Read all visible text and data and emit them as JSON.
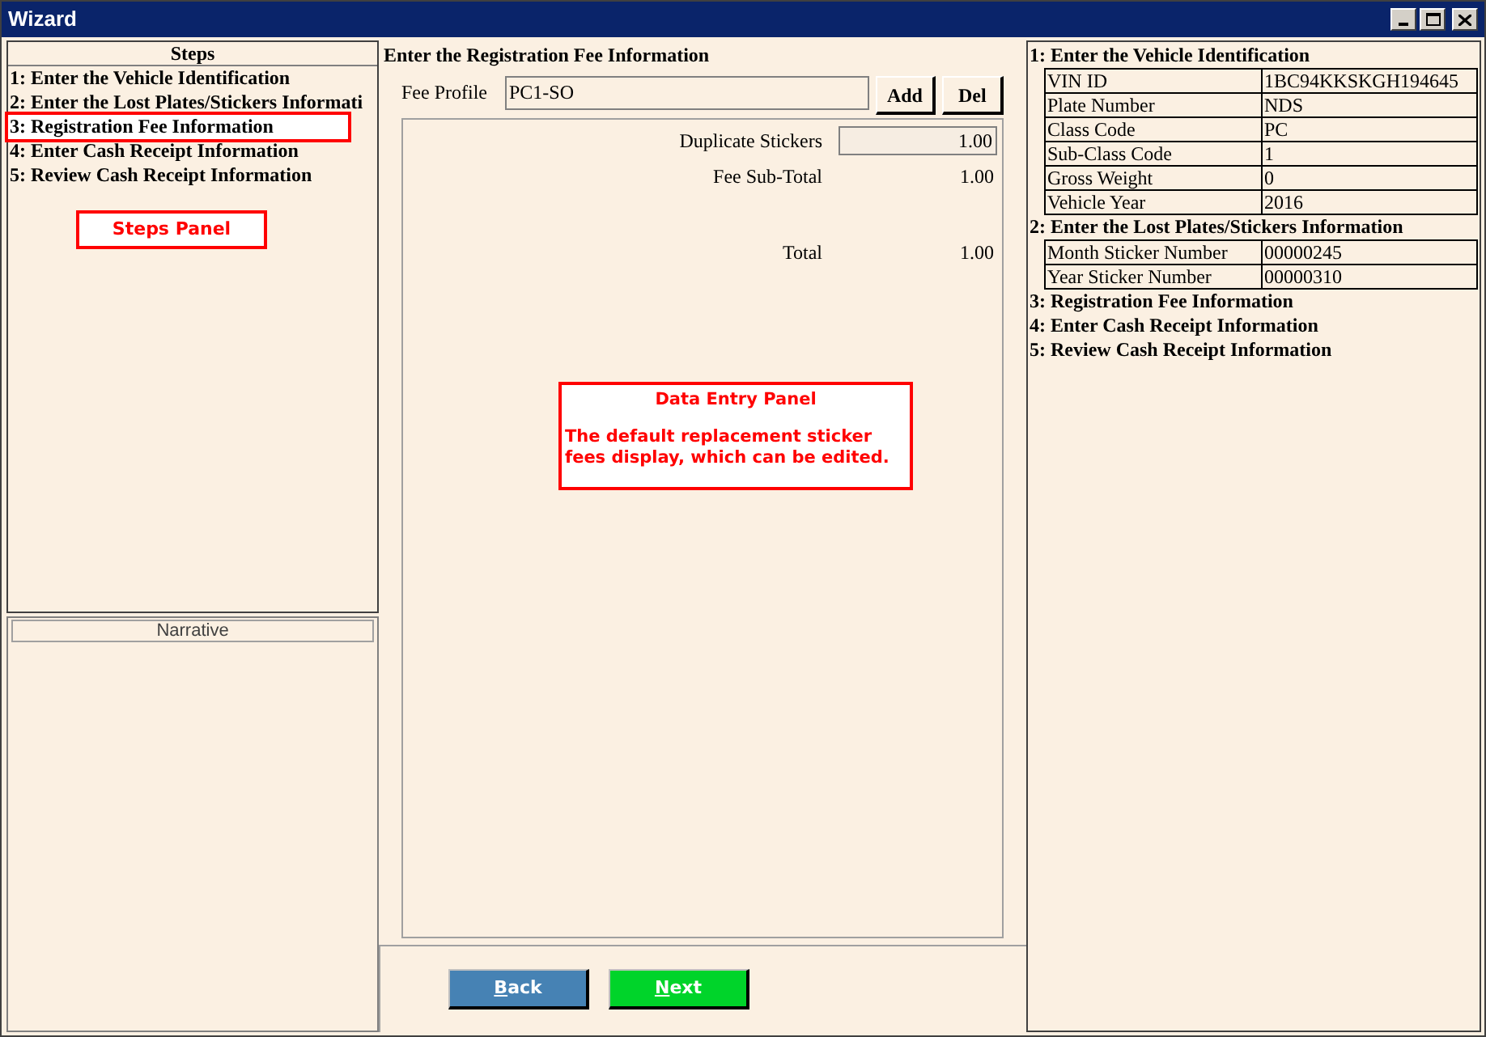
{
  "window": {
    "title": "Wizard"
  },
  "steps_panel": {
    "title": "Steps",
    "items": [
      {
        "label": "1: Enter the Vehicle Identification",
        "selected": false
      },
      {
        "label": "2: Enter the Lost Plates/Stickers Informati",
        "selected": false
      },
      {
        "label": "3: Registration Fee Information",
        "selected": true
      },
      {
        "label": "4: Enter Cash Receipt Information",
        "selected": false
      },
      {
        "label": "5: Review Cash Receipt Information",
        "selected": false
      }
    ],
    "callout": "Steps Panel"
  },
  "narrative": {
    "title": "Narrative"
  },
  "data_entry": {
    "heading": "Enter the Registration Fee Information",
    "fee_profile_label": "Fee Profile",
    "fee_profile_value": "PC1-SO",
    "buttons": [
      "Add",
      "Del"
    ],
    "rows": [
      {
        "kind": "field",
        "label": "Duplicate Stickers",
        "value": "1.00"
      },
      {
        "kind": "text",
        "label": "Fee Sub-Total",
        "value": "1.00"
      },
      {
        "kind": "total",
        "label": "Total",
        "value": "1.00"
      }
    ],
    "callout_title": "Data Entry Panel",
    "callout_text": "The default replacement sticker fees display, which can be edited."
  },
  "nav_buttons": [
    {
      "label": "Back",
      "kind": "back"
    },
    {
      "label": "Next",
      "kind": "next"
    }
  ],
  "summary": {
    "sections": [
      {
        "title": "1: Enter the Vehicle Identification",
        "rows": [
          [
            "VIN ID",
            "1BC94KKSKGH194645"
          ],
          [
            "Plate Number",
            "NDS"
          ],
          [
            "Class Code",
            "PC"
          ],
          [
            "Sub-Class Code",
            "1"
          ],
          [
            "Gross Weight",
            "0"
          ],
          [
            "Vehicle Year",
            "2016"
          ]
        ]
      },
      {
        "title": "2: Enter the Lost Plates/Stickers Information",
        "rows": [
          [
            "Month Sticker Number",
            "00000245"
          ],
          [
            "Year Sticker Number",
            "00000310"
          ]
        ]
      },
      {
        "title": "3: Registration Fee Information"
      },
      {
        "title": "4: Enter Cash Receipt Information"
      },
      {
        "title": "5: Review Cash Receipt Information"
      }
    ]
  }
}
